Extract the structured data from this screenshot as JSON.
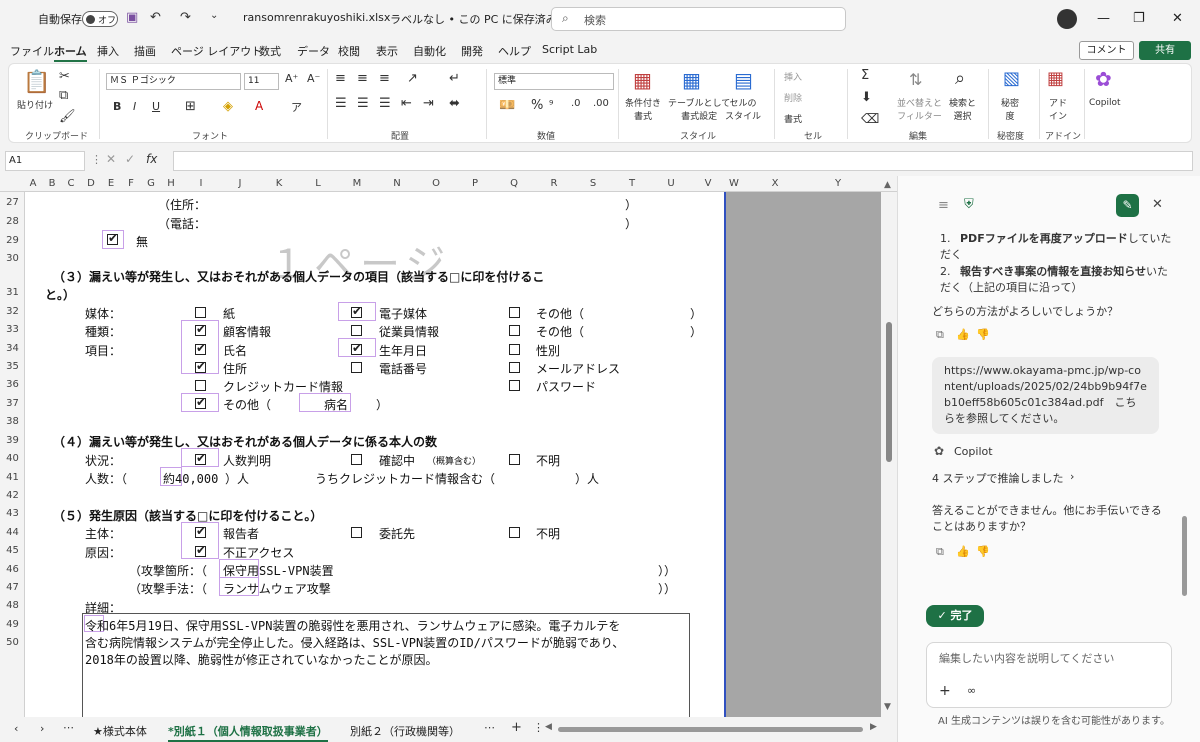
{
  "titlebar": {
    "autosave": "自動保存",
    "toggle": "オフ",
    "filename": "ransomrenrakuyoshiki.xlsx",
    "label_status": "ラベルなし • この PC に保存済み",
    "search_placeholder": "検索"
  },
  "menu": {
    "items": [
      "ファイル",
      "ホーム",
      "挿入",
      "描画",
      "ページ レイアウト",
      "数式",
      "データ",
      "校閲",
      "表示",
      "自動化",
      "開発",
      "ヘルプ",
      "Script Lab"
    ],
    "comment": "コメント",
    "share": "共有"
  },
  "ribbon": {
    "paste": "貼り付け",
    "clipboard": "クリップボード",
    "font_name": "ＭＳ Ｐゴシック",
    "font_size": "11",
    "font": "フォント",
    "alignment": "配置",
    "number_format": "標準",
    "number": "数値",
    "cond_format": "条件付き\n書式",
    "table_format": "テーブルとして\n書式設定",
    "cell_style": "セルの\nスタイル",
    "style": "スタイル",
    "insert": "挿入",
    "delete": "削除",
    "format": "書式",
    "cells": "セル",
    "sort": "並べ替えと\nフィルター",
    "find": "検索と\n選択",
    "edit": "編集",
    "sensitivity": "秘密\n度",
    "sensitivity_grp": "秘密度",
    "addin": "アド\nイン",
    "addin_grp": "アドイン",
    "copilot": "Copilot"
  },
  "formula": {
    "cell": "A1",
    "fx": "fx"
  },
  "columns": [
    "A",
    "B",
    "C",
    "D",
    "E",
    "F",
    "G",
    "H",
    "I",
    "J",
    "K",
    "L",
    "M",
    "N",
    "O",
    "P",
    "Q",
    "R",
    "S",
    "T",
    "U",
    "V",
    "W",
    "X",
    "Y"
  ],
  "rows": [
    "27",
    "28",
    "29",
    "30",
    "31",
    "32",
    "33",
    "34",
    "35",
    "36",
    "37",
    "38",
    "39",
    "40",
    "41",
    "42",
    "43",
    "44",
    "45",
    "46",
    "47",
    "48",
    "49",
    "50"
  ],
  "sheet": {
    "address_open": "（住所：",
    "address_close": "）",
    "phone_open": "（電話：",
    "phone_close": "）",
    "none": "無",
    "watermark": "１ページ",
    "s3_title_1": "（３）漏えい等が発生し、又はおそれがある個人データの項目（該当する□に印を付けるこ",
    "s3_title_2": "と。）",
    "medium": "媒体：",
    "paper": "紙",
    "electronic": "電子媒体",
    "other": "その他（",
    "close_paren": "）",
    "type": "種類：",
    "customer": "顧客情報",
    "employee": "従業員情報",
    "item": "項目：",
    "name": "氏名",
    "birth": "生年月日",
    "gender": "性別",
    "address": "住所",
    "phone": "電話番号",
    "email": "メールアドレス",
    "credit": "クレジットカード情報",
    "password": "パスワード",
    "other2": "その他（",
    "disease": "病名",
    "close2": "）",
    "s4_title": "（４）漏えい等が発生し、又はおそれがある個人データに係る本人の数",
    "status": "状況：",
    "known": "人数判明",
    "confirming": "確認中",
    "estimate": "（概算含む）",
    "unknown": "不明",
    "count_lbl": "人数：（",
    "count_val": "約40,000",
    "count_unit": "）人",
    "credit_count": "うちクレジットカード情報含む（",
    "credit_unit": "）人",
    "s5_title": "（５）発生原因（該当する□に印を付けること。）",
    "subject": "主体：",
    "reporter": "報告者",
    "contractor": "委託先",
    "unknown2": "不明",
    "cause": "原因：",
    "unauth": "不正アクセス",
    "attack_place": "（攻撃箇所：（",
    "attack_place_val": "保守用SSL-VPN装置",
    "attack_place_close": "））",
    "attack_method": "（攻撃手法：（",
    "attack_method_val": "ランサムウェア攻撃",
    "attack_method_close": "））",
    "detail_lbl": "詳細：",
    "detail_1": "令和6年5月19日、保守用SSL-VPN装置の脆弱性を悪用され、ランサムウェアに感染。電子カルテを",
    "detail_2": "含む病院情報システムが完全停止した。侵入経路は、SSL-VPN装置のID/パスワードが脆弱であり、",
    "detail_3": "2018年の設置以降、脆弱性が修正されていなかったことが原因。"
  },
  "tabs": {
    "sheet1": "★様式本体",
    "sheet2": "*別紙１（個人情報取扱事業者）",
    "sheet3": "別紙２（行政機関等）"
  },
  "copilot": {
    "list1a": "PDFファイルを再度アップロード",
    "list1b": "していただく",
    "list2a": "報告すべき事案の情報を直接お知らせ",
    "list2b": "いただく（上記の項目に沿って）",
    "question": "どちらの方法がよろしいでしょうか？",
    "user_msg": "https://www.okayama-pmc.jp/wp-content/uploads/2025/02/24bb9b94f7eb10eff58b605c01c384ad.pdf　こちらを参照してください。",
    "name": "Copilot",
    "reasoning": "4 ステップで推論しました",
    "answer": "答えることができません。他にお手伝いできることはありますか？",
    "done": "完了",
    "input_placeholder": "編集したい内容を説明してください",
    "disclaimer": "AI 生成コンテンツは誤りを含む可能性があります。"
  }
}
